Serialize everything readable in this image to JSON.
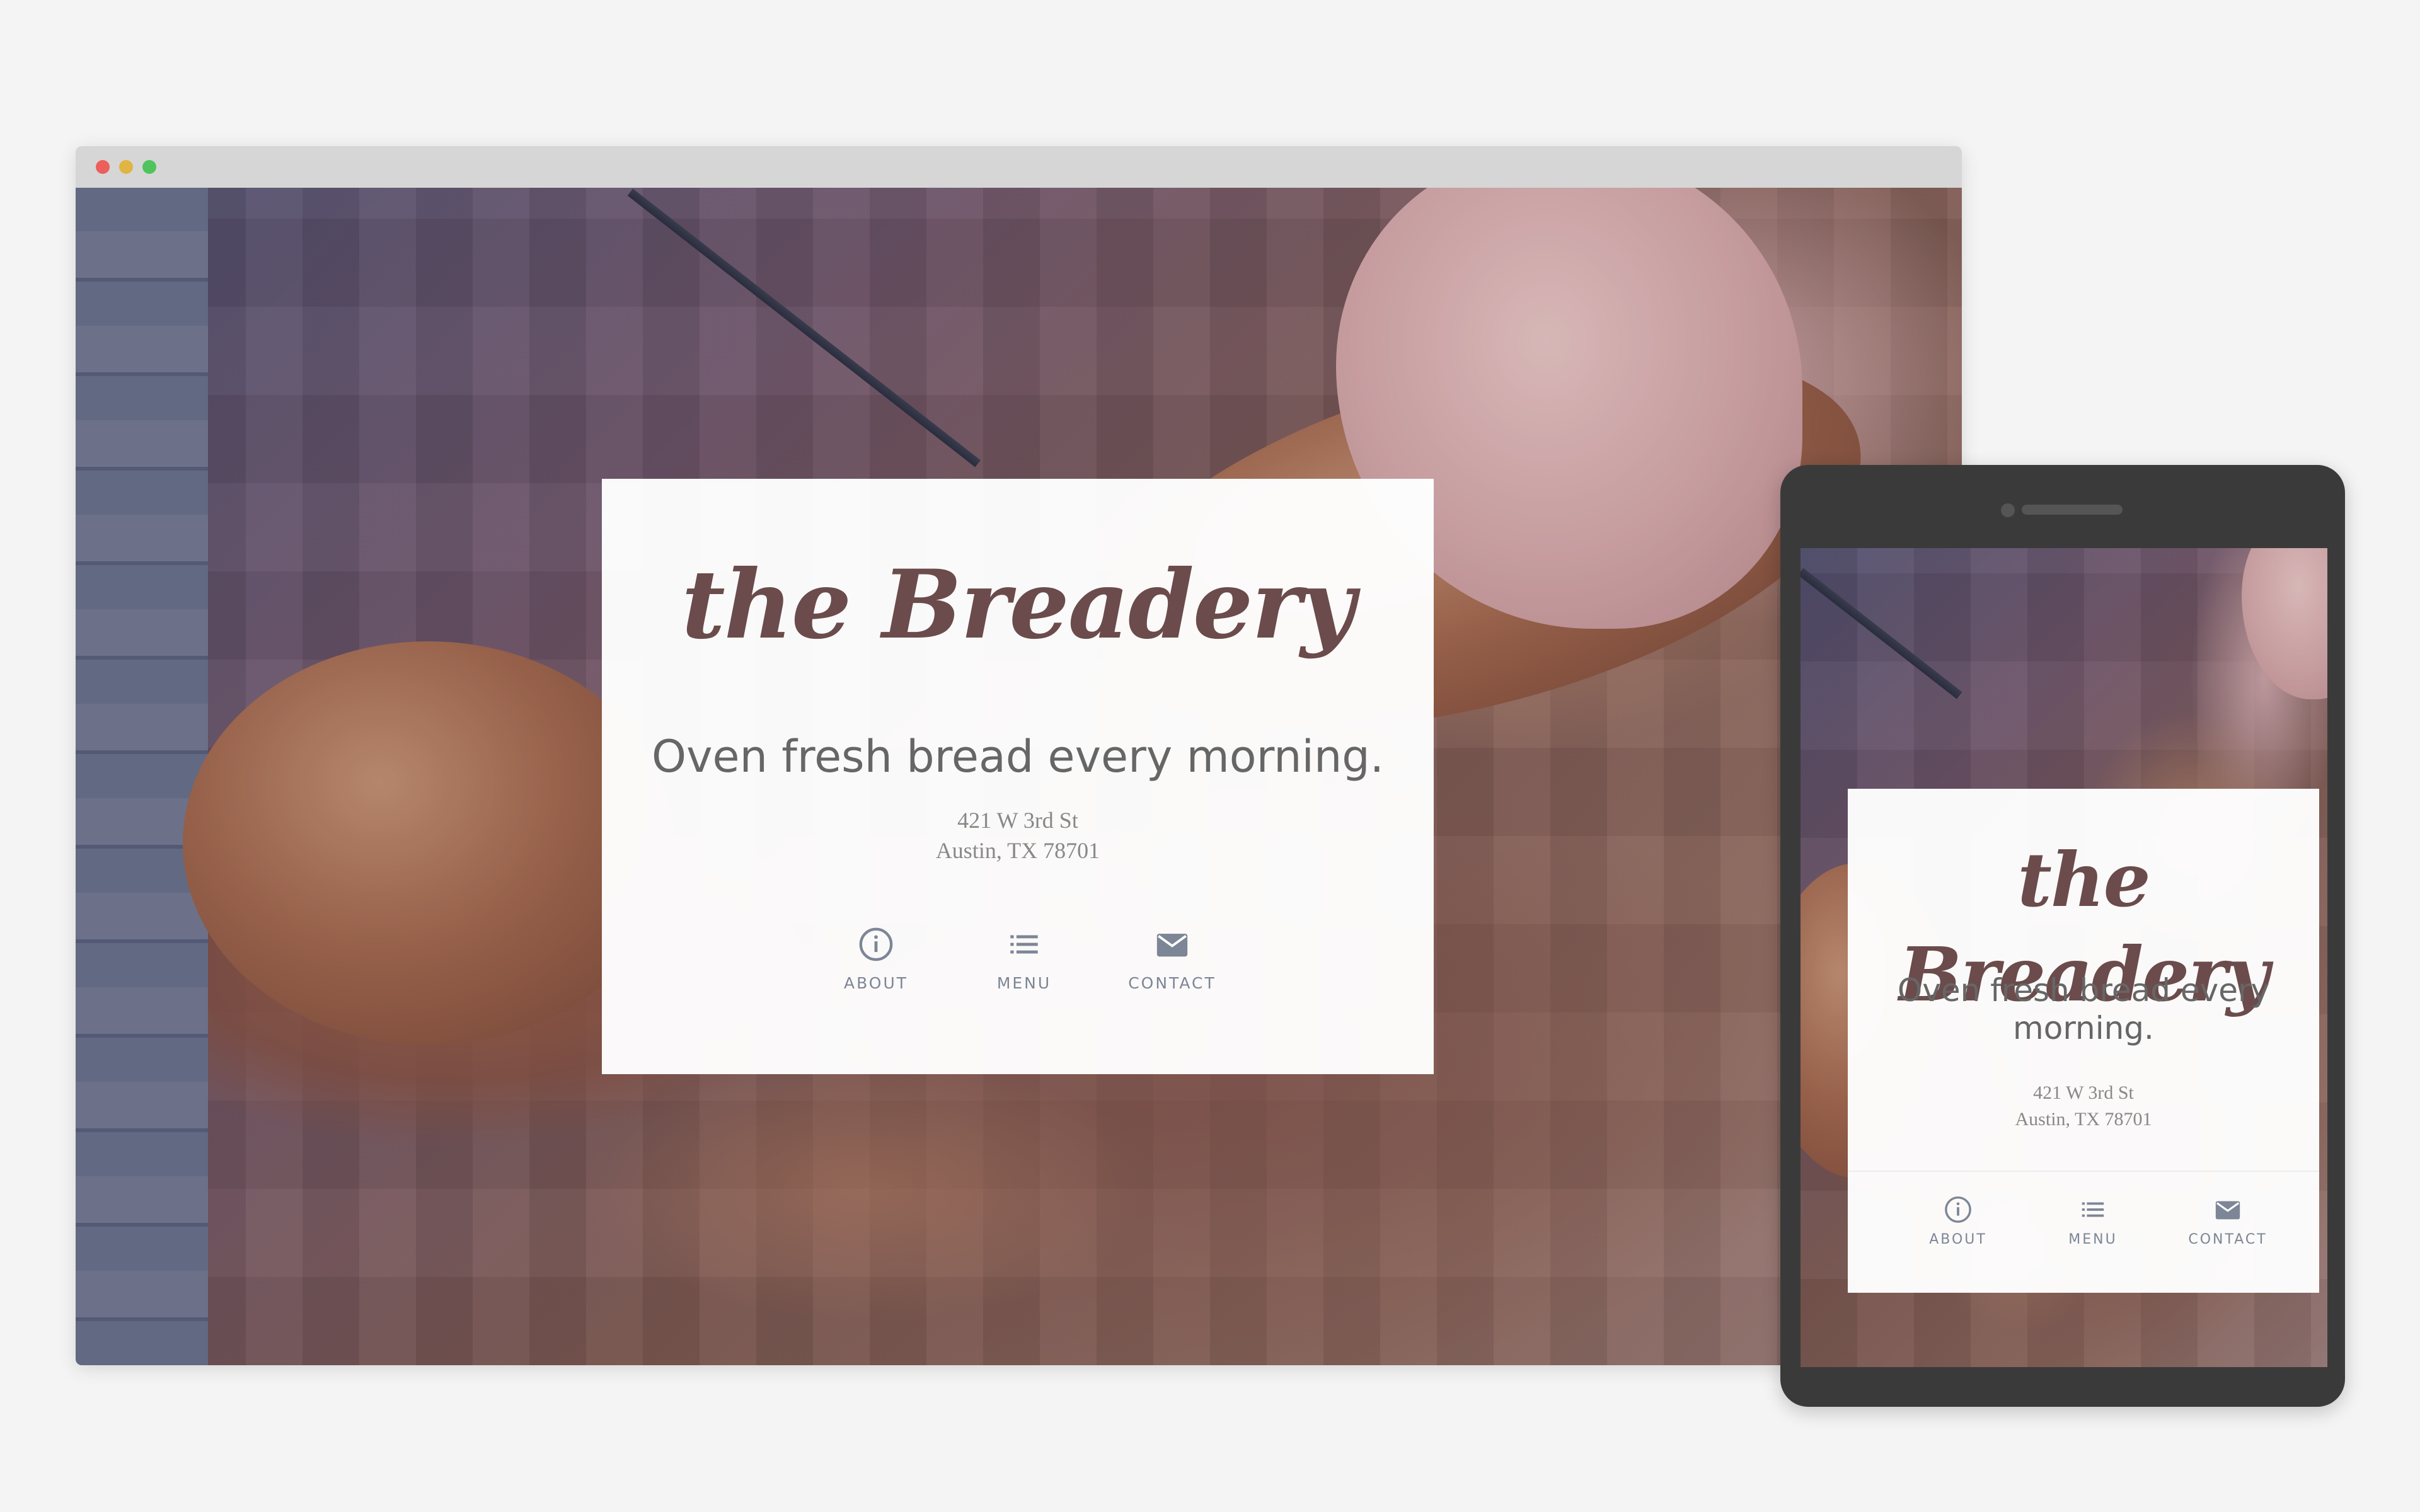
{
  "brand": {
    "name": "the Breadery",
    "tagline": "Oven fresh bread every morning.",
    "address_line1": "421 W 3rd St",
    "address_line2": "Austin, TX 78701"
  },
  "nav": [
    {
      "label": "ABOUT",
      "icon": "info-icon"
    },
    {
      "label": "MENU",
      "icon": "list-icon"
    },
    {
      "label": "CONTACT",
      "icon": "mail-icon"
    }
  ],
  "colors": {
    "logo": "#6b4b4b",
    "nav_icon": "#7d8696",
    "traffic_red": "#ec5f5a",
    "traffic_yellow": "#e0b542",
    "traffic_green": "#4fc45d",
    "phone_frame": "#3b3a3a",
    "background": "#f4f4f4"
  }
}
